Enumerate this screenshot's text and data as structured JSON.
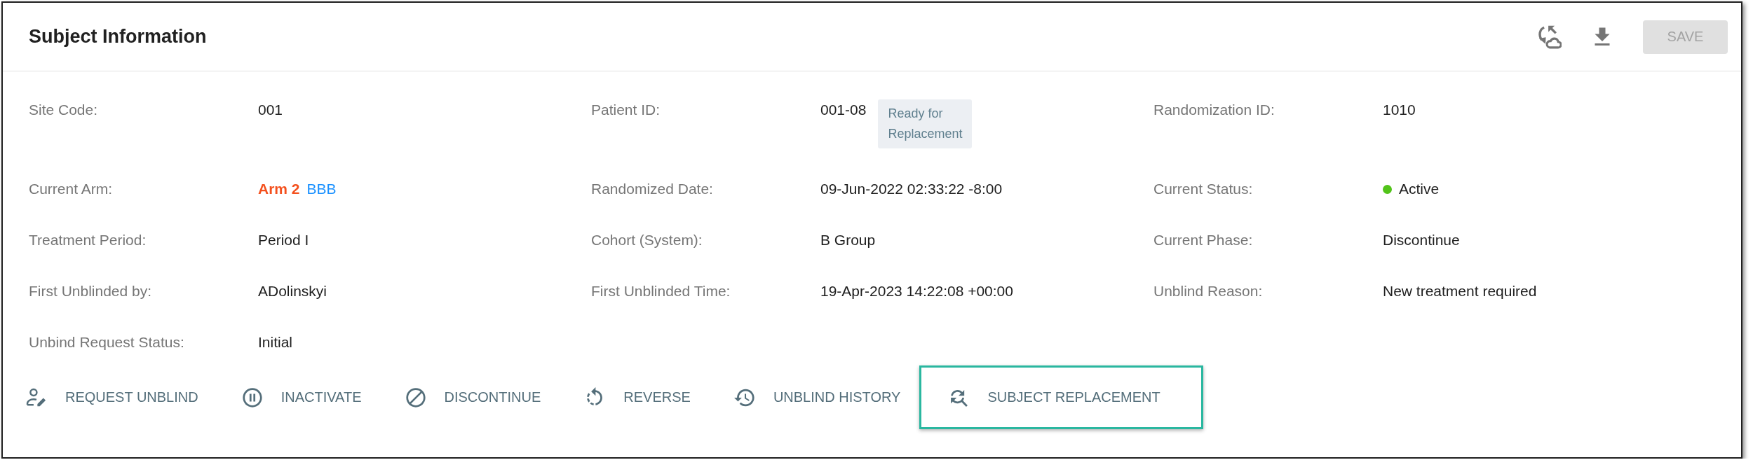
{
  "panel": {
    "title": "Subject Information"
  },
  "save_button": {
    "label": "SAVE",
    "disabled": true
  },
  "fields": [
    {
      "label": "Site Code:",
      "kind": "text",
      "value": "001"
    },
    {
      "label": "Patient ID:",
      "kind": "badge",
      "value": "001-08",
      "badge": "Ready for Replacement"
    },
    {
      "label": "Randomization ID:",
      "kind": "text",
      "value": "1010"
    },
    {
      "label": "Current Arm:",
      "kind": "arm",
      "parts": [
        {
          "text": "Arm 2",
          "color": "#f4511e",
          "bold": true
        },
        {
          "text": "BBB",
          "color": "#1890ff",
          "bold": false
        }
      ]
    },
    {
      "label": "Randomized Date:",
      "kind": "text",
      "value": "09-Jun-2022 02:33:22 -8:00"
    },
    {
      "label": "Current Status:",
      "kind": "status",
      "value": "Active",
      "color": "#52c41a"
    },
    {
      "label": "Treatment Period:",
      "kind": "text",
      "value": "Period I"
    },
    {
      "label": "Cohort (System):",
      "kind": "text",
      "value": "B Group"
    },
    {
      "label": "Current Phase:",
      "kind": "text",
      "value": "Discontinue"
    },
    {
      "label": "First Unblinded by:",
      "kind": "text",
      "value": "ADolinskyi"
    },
    {
      "label": "First Unblinded Time:",
      "kind": "text",
      "value": "19-Apr-2023 14:22:08 +00:00"
    },
    {
      "label": "Unblind Reason:",
      "kind": "text",
      "value": "New treatment required"
    },
    {
      "label": "Unbind Request Status:",
      "kind": "text",
      "value": "Initial"
    }
  ],
  "actions": [
    {
      "label": "REQUEST UNBLIND",
      "highlighted": false
    },
    {
      "label": "INACTIVATE",
      "highlighted": false
    },
    {
      "label": "DISCONTINUE",
      "highlighted": false
    },
    {
      "label": "REVERSE",
      "highlighted": false
    },
    {
      "label": "UNBLIND HISTORY",
      "highlighted": false
    },
    {
      "label": "SUBJECT REPLACEMENT",
      "highlighted": true
    }
  ]
}
